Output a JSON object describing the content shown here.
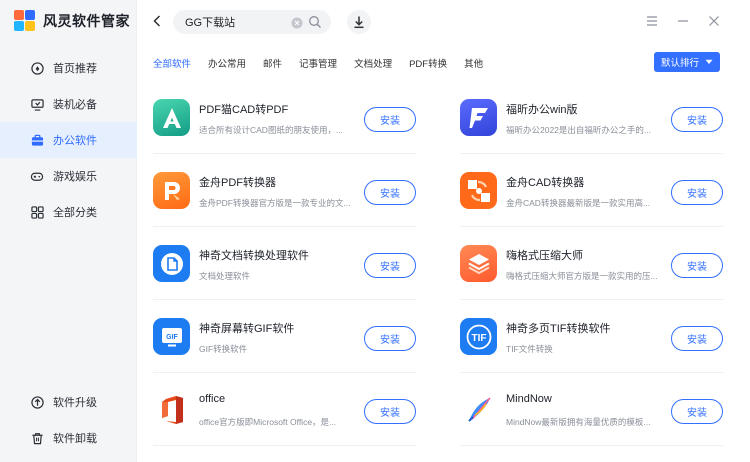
{
  "app": {
    "title": "风灵软件管家"
  },
  "sidebar": {
    "items": [
      {
        "label": "首页推荐",
        "icon": "home-icon"
      },
      {
        "label": "装机必备",
        "icon": "monitor-icon"
      },
      {
        "label": "办公软件",
        "icon": "briefcase-icon",
        "active": true
      },
      {
        "label": "游戏娱乐",
        "icon": "gamepad-icon"
      },
      {
        "label": "全部分类",
        "icon": "grid-icon"
      }
    ],
    "bottom": [
      {
        "label": "软件升级",
        "icon": "upgrade-icon"
      },
      {
        "label": "软件卸载",
        "icon": "trash-icon"
      }
    ]
  },
  "search": {
    "value": "GG下载站",
    "placeholder": ""
  },
  "tabs": [
    "全部软件",
    "办公常用",
    "邮件",
    "记事管理",
    "文档处理",
    "PDF转换",
    "其他"
  ],
  "sort": {
    "label": "默认排行"
  },
  "install_label": "安装",
  "apps": [
    {
      "name": "PDF猫CAD转PDF",
      "desc": "适合所有设计CAD图纸的朋友使用，...",
      "icon": "pdfcat-cad-icon"
    },
    {
      "name": "福昕办公win版",
      "desc": "福昕办公2022是出自福昕办公之手的...",
      "icon": "foxit-office-icon"
    },
    {
      "name": "金舟PDF转换器",
      "desc": "金舟PDF转换器官方版是一款专业的文...",
      "icon": "jinzhou-pdf-icon"
    },
    {
      "name": "金舟CAD转换器",
      "desc": "金舟CAD转换器最新版是一款实用高...",
      "icon": "jinzhou-cad-icon"
    },
    {
      "name": "神奇文档转换处理软件",
      "desc": "文档处理软件",
      "icon": "magic-doc-icon"
    },
    {
      "name": "嗨格式压缩大师",
      "desc": "嗨格式压缩大师官方版是一款实用的压...",
      "icon": "hi-compress-icon"
    },
    {
      "name": "神奇屏幕转GIF软件",
      "desc": "GIF转换软件",
      "icon": "magic-gif-icon"
    },
    {
      "name": "神奇多页TIF转换软件",
      "desc": "TIF文件转换",
      "icon": "magic-tif-icon"
    },
    {
      "name": "office",
      "desc": "office官方版即Microsoft Office，是...",
      "icon": "office-icon"
    },
    {
      "name": "MindNow",
      "desc": "MindNow最新版拥有海量优质的模板...",
      "icon": "mindnow-icon"
    }
  ],
  "colors": {
    "accent": "#3370ff",
    "active_bg": "#e6effe"
  }
}
